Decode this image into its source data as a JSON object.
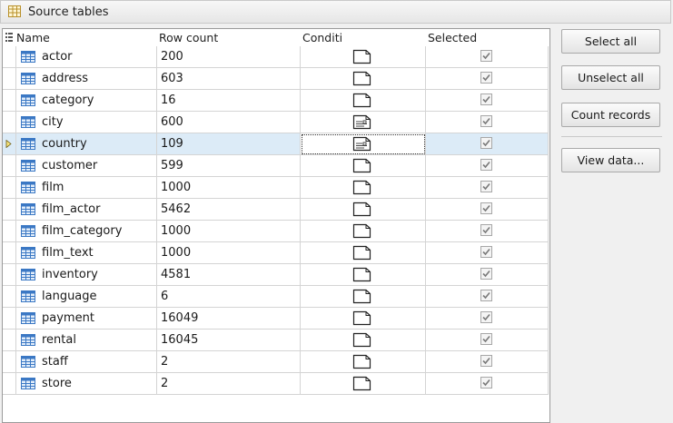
{
  "panel": {
    "title": "Source tables"
  },
  "grid": {
    "columns": {
      "name": "Name",
      "row_count": "Row count",
      "condition": "Conditi",
      "selected": "Selected"
    },
    "rows": [
      {
        "name": "actor",
        "row_count": "200",
        "condition_icon": "blank-doc-icon",
        "selected": true
      },
      {
        "name": "address",
        "row_count": "603",
        "condition_icon": "blank-doc-icon",
        "selected": true
      },
      {
        "name": "category",
        "row_count": "16",
        "condition_icon": "blank-doc-icon",
        "selected": true
      },
      {
        "name": "city",
        "row_count": "600",
        "condition_icon": "filter-doc-icon",
        "selected": true
      },
      {
        "name": "country",
        "row_count": "109",
        "condition_icon": "filter-doc-icon",
        "selected": true,
        "current": true
      },
      {
        "name": "customer",
        "row_count": "599",
        "condition_icon": "blank-doc-icon",
        "selected": true
      },
      {
        "name": "film",
        "row_count": "1000",
        "condition_icon": "blank-doc-icon",
        "selected": true
      },
      {
        "name": "film_actor",
        "row_count": "5462",
        "condition_icon": "blank-doc-icon",
        "selected": true
      },
      {
        "name": "film_category",
        "row_count": "1000",
        "condition_icon": "blank-doc-icon",
        "selected": true
      },
      {
        "name": "film_text",
        "row_count": "1000",
        "condition_icon": "blank-doc-icon",
        "selected": true
      },
      {
        "name": "inventory",
        "row_count": "4581",
        "condition_icon": "blank-doc-icon",
        "selected": true
      },
      {
        "name": "language",
        "row_count": "6",
        "condition_icon": "blank-doc-icon",
        "selected": true
      },
      {
        "name": "payment",
        "row_count": "16049",
        "condition_icon": "blank-doc-icon",
        "selected": true
      },
      {
        "name": "rental",
        "row_count": "16045",
        "condition_icon": "blank-doc-icon",
        "selected": true
      },
      {
        "name": "staff",
        "row_count": "2",
        "condition_icon": "blank-doc-icon",
        "selected": true
      },
      {
        "name": "store",
        "row_count": "2",
        "condition_icon": "blank-doc-icon",
        "selected": true
      }
    ]
  },
  "buttons": {
    "select_all": "Select all",
    "unselect_all": "Unselect all",
    "count_records": "Count records",
    "view_data": "View data..."
  },
  "colors": {
    "selection_row": "#dcebf7",
    "table_icon": "#3b78c4",
    "checkbox_disabled": "#a7a7a7"
  }
}
